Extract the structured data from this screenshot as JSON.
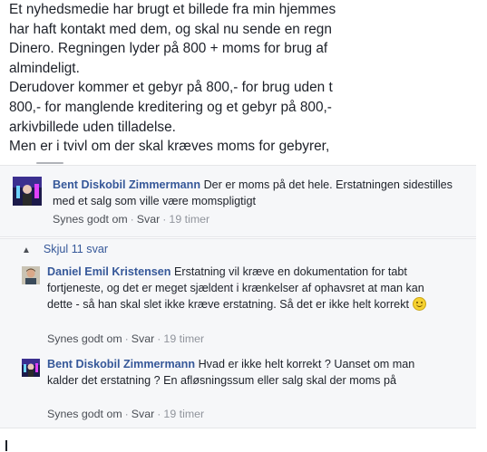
{
  "post": {
    "lines": [
      "Et nyhedsmedie har brugt et billede fra min hjemmes",
      "har haft kontakt med dem, og skal nu sende en regn",
      "Dinero. Regningen lyder på 800 + moms for brug af",
      "almindeligt.",
      "Derudover kommer et gebyr på 800,- for brug uden t",
      "800,- for manglende kreditering og et gebyr på 800,-",
      "arkivbillede uden tilladelse.",
      "Men er i tvivl om der skal kræves moms for gebyrer,"
    ]
  },
  "comment": {
    "author": "Bent Diskobil Zimmermann",
    "text": "Der er moms på det hele. Erstatningen sidestilles med et salg som ville være momspligtigt",
    "like_label": "Synes godt om",
    "reply_label": "Svar",
    "time": "19 timer"
  },
  "replies_toggle": {
    "label": "Skjul 11 svar"
  },
  "replies": [
    {
      "author": "Daniel Emil Kristensen",
      "text": "Erstatning vil kræve en dokumentation for tabt fortjeneste, og det er meget sjældent i krænkelser af ophavsret at man kan dette - så han skal slet ikke kræve erstatning. Så det er ikke helt korrekt",
      "like_label": "Synes godt om",
      "reply_label": "Svar",
      "time": "19 timer"
    },
    {
      "author": "Bent Diskobil Zimmermann",
      "text": "Hvad er ikke helt korrekt ? Uanset om man kalder det erstatning ? En afløsningssum eller salg skal der moms på",
      "like_label": "Synes godt om",
      "reply_label": "Svar",
      "time": "19 timer"
    }
  ],
  "colors": {
    "author_link": "#365899",
    "body_text": "#1d2129",
    "meta_text": "#90949c",
    "panel_bg": "#f6f7f9"
  }
}
